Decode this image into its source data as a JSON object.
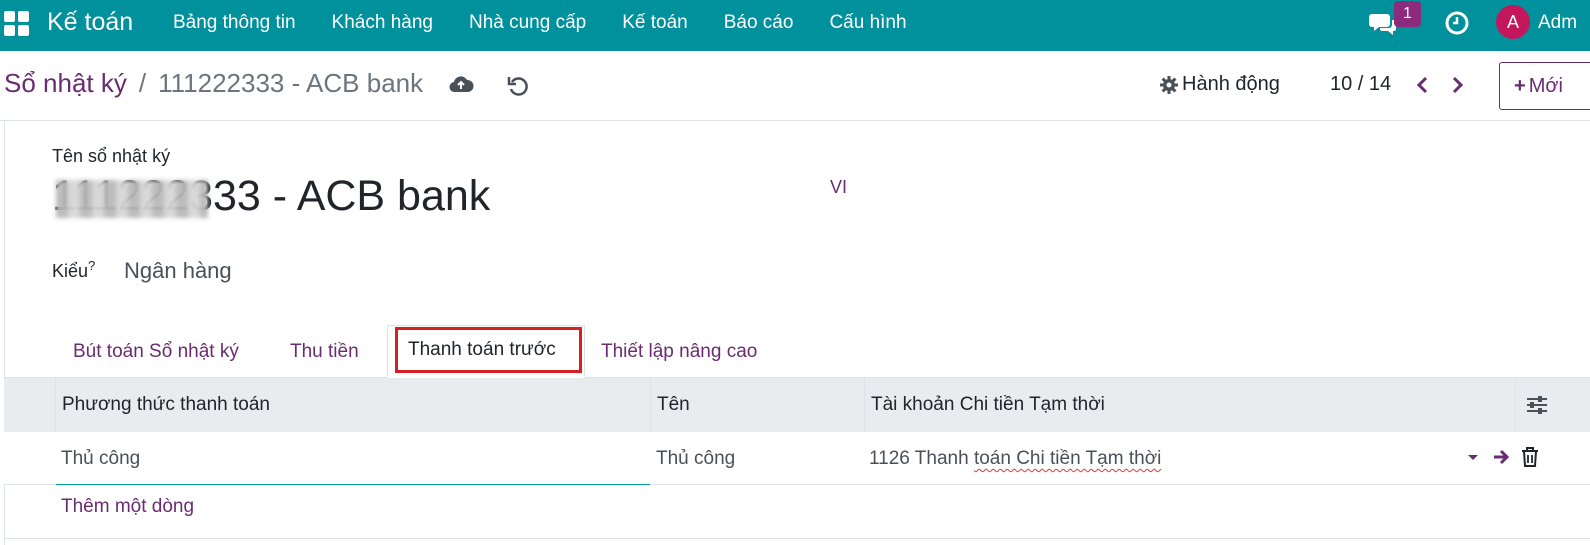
{
  "navbar": {
    "brand": "Kế toán",
    "menu": [
      "Bảng thông tin",
      "Khách hàng",
      "Nhà cung cấp",
      "Kế toán",
      "Báo cáo",
      "Cấu hình"
    ],
    "chat_count": "1",
    "avatar_letter": "A",
    "username": "Adm"
  },
  "control": {
    "breadcrumb_parent": "Sổ nhật ký",
    "breadcrumb_sep": "/",
    "breadcrumb_current": "111222333 - ACB bank",
    "action_label": "Hành động",
    "pager": "10 / 14",
    "new_label": "Mới"
  },
  "form": {
    "name_label": "Tên sổ nhật ký",
    "name_value": "111222333 - ACB bank",
    "lang": "VI",
    "type_label": "Kiểu",
    "type_help": "?",
    "type_value": "Ngân hàng"
  },
  "tabs": [
    {
      "label": "Bút toán Sổ nhật ký"
    },
    {
      "label": "Thu tiền"
    },
    {
      "label": "Thanh toán trước"
    },
    {
      "label": "Thiết lập nâng cao"
    }
  ],
  "table": {
    "columns": [
      "Phương thức thanh toán",
      "Tên",
      "Tài khoản Chi tiền Tạm thời"
    ],
    "rows": [
      {
        "method": "Thủ công",
        "name": "Thủ công",
        "account_code": "1126 Thanh",
        "account_rest": "toán Chi tiền Tạm thời"
      }
    ],
    "add_line": "Thêm một dòng"
  },
  "colors": {
    "navbar": "#00919c",
    "primary": "#6a2c70",
    "highlight": "#d91f26"
  }
}
